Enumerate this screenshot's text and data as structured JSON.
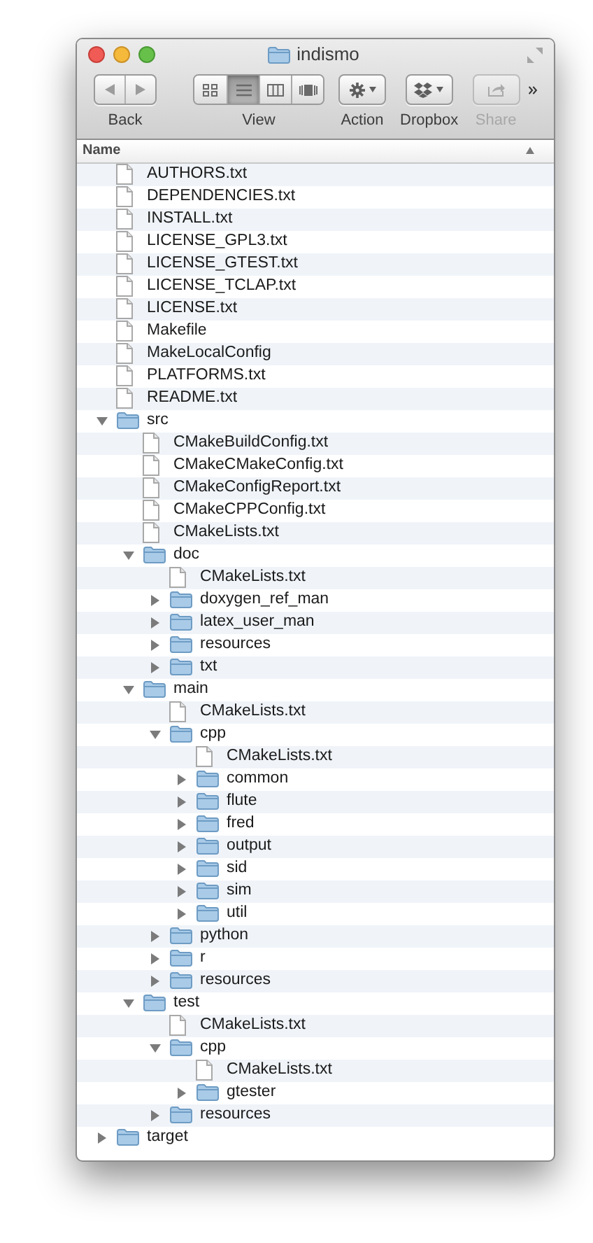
{
  "window": {
    "title": "indismo"
  },
  "toolbar": [
    {
      "kind": "back",
      "label": "Back",
      "disabled": false
    },
    {
      "kind": "view",
      "label": "View",
      "disabled": false,
      "modes": [
        {
          "kind": "icons",
          "selected": false
        },
        {
          "kind": "list",
          "selected": true
        },
        {
          "kind": "columns",
          "selected": false
        },
        {
          "kind": "coverflow",
          "selected": false
        }
      ]
    },
    {
      "kind": "action",
      "label": "Action",
      "disabled": false
    },
    {
      "kind": "dropbox",
      "label": "Dropbox",
      "disabled": false
    },
    {
      "kind": "share",
      "label": "Share",
      "disabled": true
    }
  ],
  "columns": [
    {
      "label": "Name"
    }
  ],
  "tree": [
    {
      "kind": "file",
      "name": "AUTHORS.txt"
    },
    {
      "kind": "file",
      "name": "DEPENDENCIES.txt"
    },
    {
      "kind": "file",
      "name": "INSTALL.txt"
    },
    {
      "kind": "file",
      "name": "LICENSE_GPL3.txt"
    },
    {
      "kind": "file",
      "name": "LICENSE_GTEST.txt"
    },
    {
      "kind": "file",
      "name": "LICENSE_TCLAP.txt"
    },
    {
      "kind": "file",
      "name": "LICENSE.txt"
    },
    {
      "kind": "file",
      "name": "Makefile"
    },
    {
      "kind": "file",
      "name": "MakeLocalConfig"
    },
    {
      "kind": "file",
      "name": "PLATFORMS.txt"
    },
    {
      "kind": "file",
      "name": "README.txt"
    },
    {
      "kind": "folder",
      "name": "src",
      "expanded": true,
      "children": [
        {
          "kind": "file",
          "name": "CMakeBuildConfig.txt"
        },
        {
          "kind": "file",
          "name": "CMakeCMakeConfig.txt"
        },
        {
          "kind": "file",
          "name": "CMakeConfigReport.txt"
        },
        {
          "kind": "file",
          "name": "CMakeCPPConfig.txt"
        },
        {
          "kind": "file",
          "name": "CMakeLists.txt"
        },
        {
          "kind": "folder",
          "name": "doc",
          "expanded": true,
          "children": [
            {
              "kind": "file",
              "name": "CMakeLists.txt"
            },
            {
              "kind": "folder",
              "name": "doxygen_ref_man",
              "expanded": false
            },
            {
              "kind": "folder",
              "name": "latex_user_man",
              "expanded": false
            },
            {
              "kind": "folder",
              "name": "resources",
              "expanded": false
            },
            {
              "kind": "folder",
              "name": "txt",
              "expanded": false
            }
          ]
        },
        {
          "kind": "folder",
          "name": "main",
          "expanded": true,
          "children": [
            {
              "kind": "file",
              "name": "CMakeLists.txt"
            },
            {
              "kind": "folder",
              "name": "cpp",
              "expanded": true,
              "children": [
                {
                  "kind": "file",
                  "name": "CMakeLists.txt"
                },
                {
                  "kind": "folder",
                  "name": "common",
                  "expanded": false
                },
                {
                  "kind": "folder",
                  "name": "flute",
                  "expanded": false
                },
                {
                  "kind": "folder",
                  "name": "fred",
                  "expanded": false
                },
                {
                  "kind": "folder",
                  "name": "output",
                  "expanded": false
                },
                {
                  "kind": "folder",
                  "name": "sid",
                  "expanded": false
                },
                {
                  "kind": "folder",
                  "name": "sim",
                  "expanded": false
                },
                {
                  "kind": "folder",
                  "name": "util",
                  "expanded": false
                }
              ]
            },
            {
              "kind": "folder",
              "name": "python",
              "expanded": false
            },
            {
              "kind": "folder",
              "name": "r",
              "expanded": false
            },
            {
              "kind": "folder",
              "name": "resources",
              "expanded": false
            }
          ]
        },
        {
          "kind": "folder",
          "name": "test",
          "expanded": true,
          "children": [
            {
              "kind": "file",
              "name": "CMakeLists.txt"
            },
            {
              "kind": "folder",
              "name": "cpp",
              "expanded": true,
              "children": [
                {
                  "kind": "file",
                  "name": "CMakeLists.txt"
                },
                {
                  "kind": "folder",
                  "name": "gtester",
                  "expanded": false
                }
              ]
            },
            {
              "kind": "folder",
              "name": "resources",
              "expanded": false
            }
          ]
        }
      ]
    },
    {
      "kind": "folder",
      "name": "target",
      "expanded": false
    }
  ]
}
